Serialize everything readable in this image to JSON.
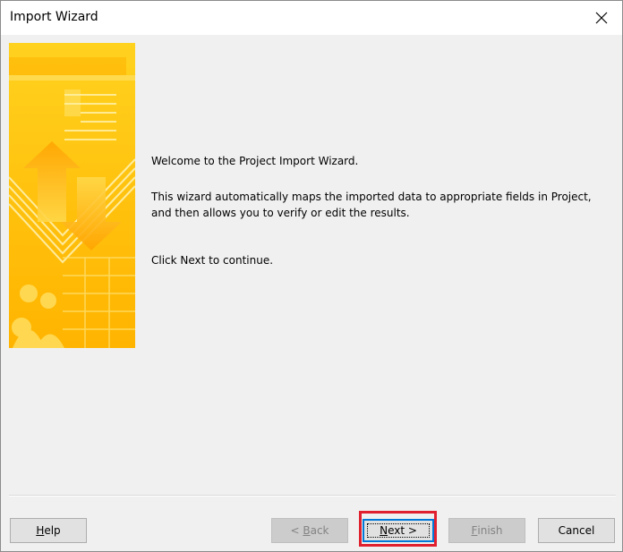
{
  "window": {
    "title": "Import Wizard"
  },
  "icons": {
    "close": "close-icon",
    "banner": "wizard-banner-image"
  },
  "content": {
    "welcome": "Welcome to the Project Import Wizard.",
    "description": "This wizard automatically maps the imported data to appropriate fields in Project, and then allows you to verify or edit the results.",
    "instruction": "Click Next to continue."
  },
  "buttons": {
    "help": {
      "mnemonic": "H",
      "rest": "elp",
      "enabled": true
    },
    "back": {
      "prefix": "< ",
      "mnemonic": "B",
      "rest": "ack",
      "enabled": false
    },
    "next": {
      "mnemonic": "N",
      "rest": "ext >",
      "enabled": true,
      "focused": true
    },
    "finish": {
      "mnemonic": "F",
      "rest": "inish",
      "enabled": false
    },
    "cancel": {
      "label": "Cancel",
      "enabled": true
    }
  },
  "colors": {
    "highlight": "#e0202f",
    "focus_border": "#0078d7",
    "banner_primary": "#ffc000",
    "banner_light": "#ffe36b"
  }
}
